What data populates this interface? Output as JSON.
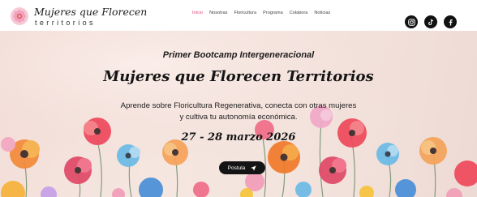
{
  "brand": {
    "title": "Mujeres que Florecen",
    "subtitle": "territorios"
  },
  "nav": {
    "items": [
      "Inicio",
      "Nosotras",
      "Floricultura",
      "Programa",
      "Colabora",
      "Noticias"
    ],
    "active": "Inicio"
  },
  "social": {
    "icons": [
      "instagram-icon",
      "tiktok-icon",
      "facebook-icon"
    ]
  },
  "hero": {
    "kicker": "Primer Bootcamp Intergeneracional",
    "title": "Mujeres que Florecen Territorios",
    "description_line1": "Aprende sobre Floricultura Regenerativa, conecta con otras mujeres",
    "description_line2": "y cultiva tu autonomía económica.",
    "date": "27 - 28 marzo 2026",
    "cta_label": "Postula",
    "cta_icon": "send-icon"
  },
  "colors": {
    "accent": "#e8477f",
    "dark": "#141414",
    "hero_bg": "#f4e4de"
  }
}
